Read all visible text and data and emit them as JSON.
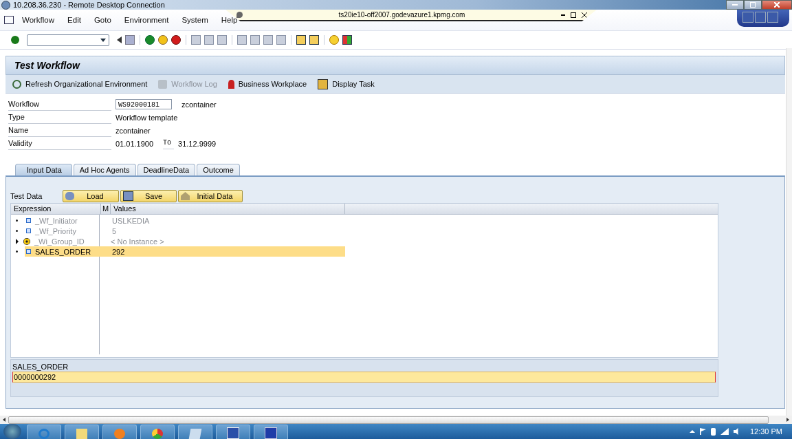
{
  "rdp_window": {
    "title": "10.208.36.230 - Remote Desktop Connection"
  },
  "connection_bar": {
    "host": "ts20ie10-off2007.godevazure1.kpmg.com"
  },
  "menu": [
    "Workflow",
    "Edit",
    "Goto",
    "Environment",
    "System",
    "Help"
  ],
  "app": {
    "title": "Test Workflow",
    "toolbar": [
      {
        "label": "Refresh Organizational Environment",
        "disabled": false
      },
      {
        "label": "Workflow Log",
        "disabled": true
      },
      {
        "label": "Business Workplace",
        "disabled": false
      },
      {
        "label": "Display Task",
        "disabled": false
      }
    ],
    "fields": [
      {
        "label": "Workflow",
        "value": "WS92000181",
        "kind": "input",
        "extra": "zcontainer"
      },
      {
        "label": "Type",
        "value": "Workflow template",
        "kind": "text"
      },
      {
        "label": "Name",
        "value": "zcontainer",
        "kind": "text"
      },
      {
        "label": "Validity",
        "value": "01.01.1900",
        "kind": "range",
        "to_label": "To",
        "to_value": "31.12.9999"
      }
    ],
    "tabs": [
      {
        "label": "Input Data",
        "selected": true
      },
      {
        "label": "Ad Hoc Agents",
        "selected": false
      },
      {
        "label": "DeadlineData",
        "selected": false
      },
      {
        "label": "Outcome",
        "selected": false
      }
    ],
    "test_data": {
      "label": "Test Data",
      "buttons": [
        "Load",
        "Save",
        "Initial Data"
      ]
    },
    "tree": {
      "columns": [
        "Expression",
        "M",
        "Values"
      ],
      "rows": [
        {
          "expression": "_Wf_Initiator",
          "value": "USLKEDIA",
          "kind": "element",
          "expandable": false,
          "disabled": true,
          "selected": false
        },
        {
          "expression": "_Wf_Priority",
          "value": "5",
          "kind": "element",
          "expandable": false,
          "disabled": true,
          "selected": false
        },
        {
          "expression": "_Wi_Group_ID",
          "value": "< No Instance >",
          "kind": "object",
          "expandable": true,
          "disabled": true,
          "selected": false
        },
        {
          "expression": "SALES_ORDER",
          "value": "292",
          "kind": "element",
          "expandable": false,
          "disabled": false,
          "selected": true
        }
      ]
    },
    "detail": {
      "label": "SALES_ORDER",
      "value": "0000000292"
    }
  },
  "taskbar": {
    "clock": "12:30 PM"
  }
}
